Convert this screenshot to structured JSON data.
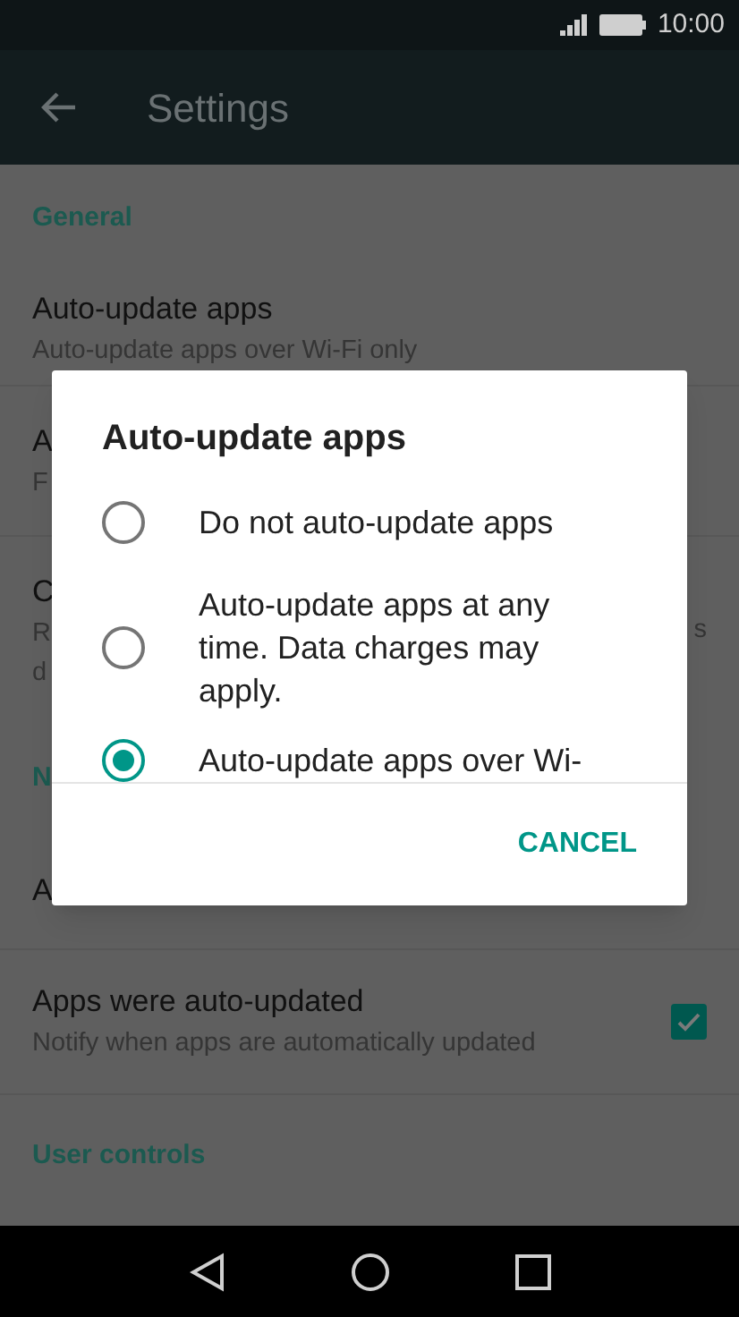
{
  "status_bar": {
    "time": "10:00"
  },
  "app_bar": {
    "title": "Settings"
  },
  "sections": [
    {
      "header": "General",
      "rows": [
        {
          "title": "Auto-update apps",
          "subtitle": "Auto-update apps over Wi-Fi only"
        },
        {
          "title": "A",
          "subtitle": "F"
        },
        {
          "title": "C",
          "subtitle": "R",
          "subtitle_2": "d",
          "trailing": "s"
        }
      ]
    },
    {
      "header": "N",
      "rows": [
        {
          "title": "A"
        },
        {
          "title": "Apps were auto-updated",
          "subtitle": "Notify when apps are automatically updated",
          "checkbox": {
            "checked": true
          }
        }
      ]
    },
    {
      "header": "User controls"
    }
  ],
  "dialog": {
    "title": "Auto-update apps",
    "options": [
      {
        "label": "Do not auto-update apps",
        "selected": false
      },
      {
        "label": "Auto-update apps at any time. Data charges may apply.",
        "selected": false
      },
      {
        "label": "Auto-update apps over Wi-",
        "selected": true
      }
    ],
    "button": "CANCEL"
  }
}
